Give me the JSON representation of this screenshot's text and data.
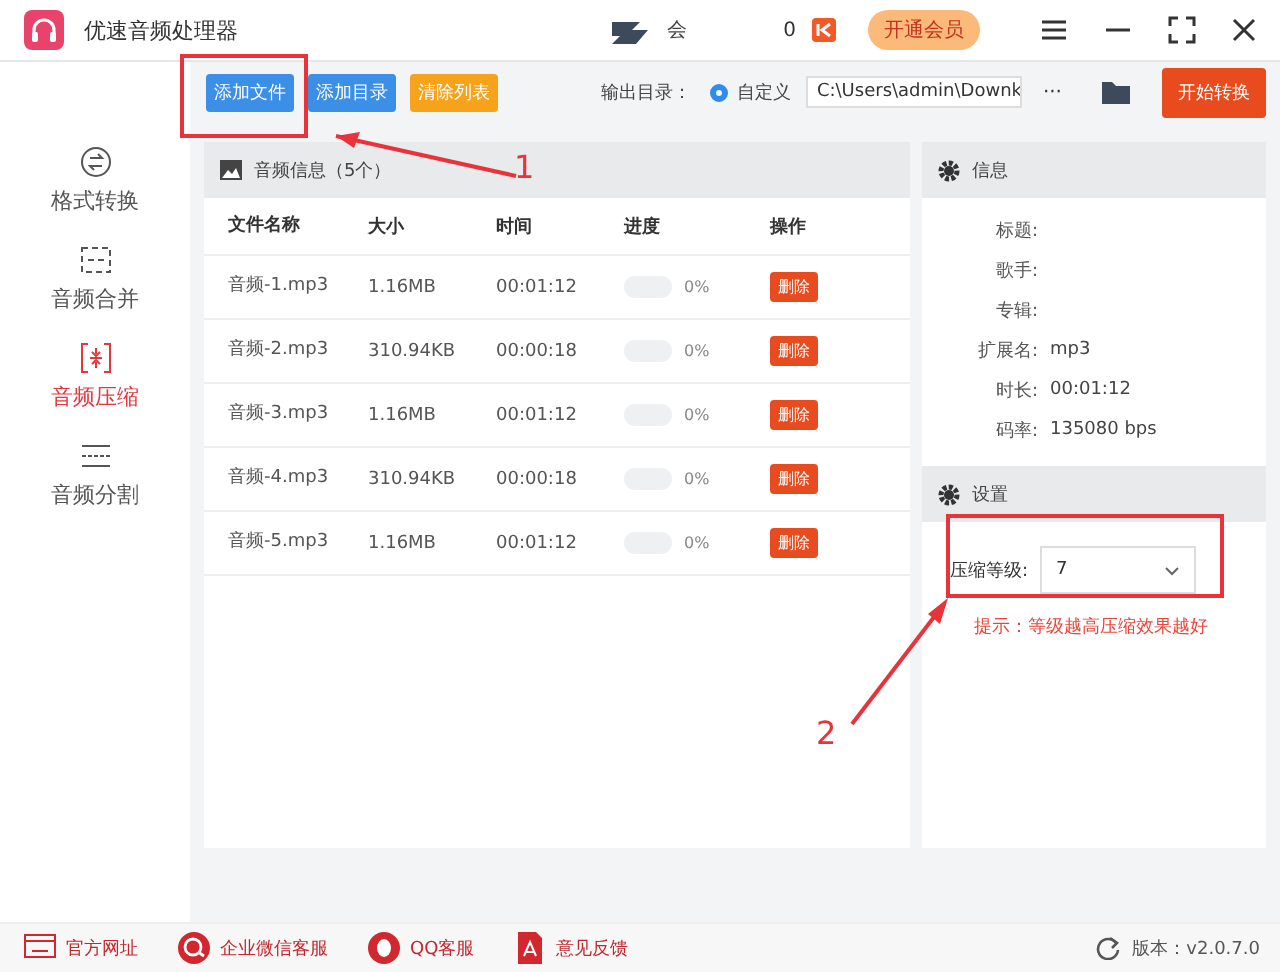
{
  "window": {
    "title": "优速音频处理器",
    "user": "会",
    "coins": "0",
    "vip_button": "开通会员"
  },
  "toolbar": {
    "buttons": [
      {
        "label": "添加文件",
        "kind": "blue"
      },
      {
        "label": "添加目录",
        "kind": "blue"
      },
      {
        "label": "清除列表",
        "kind": "orange"
      }
    ],
    "output_label": "输出目录：",
    "output_option": {
      "label": "自定义",
      "selected": true
    },
    "output_path": "C:\\Users\\admin\\Downk",
    "more": "···",
    "start_button": "开始转换"
  },
  "sidebar": {
    "items": [
      {
        "label": "格式转换",
        "selected": false
      },
      {
        "label": "音频合并",
        "selected": false
      },
      {
        "label": "音频压缩",
        "selected": true
      },
      {
        "label": "音频分割",
        "selected": false
      }
    ]
  },
  "file_panel": {
    "title": "音频信息（5个）",
    "columns": [
      "文件名称",
      "大小",
      "时间",
      "进度",
      "操作"
    ],
    "rows": [
      {
        "name": "音频-1.mp3",
        "size": "1.16MB",
        "time": "00:01:12",
        "reading": "0%",
        "action": "删除"
      },
      {
        "name": "音频-2.mp3",
        "size": "310.94KB",
        "time": "00:00:18",
        "reading": "0%",
        "action": "删除"
      },
      {
        "name": "音频-3.mp3",
        "size": "1.16MB",
        "time": "00:01:12",
        "reading": "0%",
        "action": "删除"
      },
      {
        "name": "音频-4.mp3",
        "size": "310.94KB",
        "time": "00:00:18",
        "reading": "0%",
        "action": "删除"
      },
      {
        "name": "音频-5.mp3",
        "size": "1.16MB",
        "time": "00:01:12",
        "reading": "0%",
        "action": "删除"
      }
    ]
  },
  "info_panel": {
    "title": "信息",
    "fields": [
      {
        "label": "标题:"
      },
      {
        "label": "歌手:"
      },
      {
        "label": "专辑:"
      },
      {
        "label": "扩展名:",
        "value": "mp3"
      },
      {
        "label": "时长:",
        "value": "00:01:12"
      },
      {
        "label": "码率:",
        "value": "135080 bps"
      }
    ]
  },
  "settings_panel": {
    "title": "设置",
    "level_label": "压缩等级:",
    "level_value": "7",
    "hint": "提示：等级越高压缩效果越好"
  },
  "footer": {
    "links": [
      {
        "label": "官方网址"
      },
      {
        "label": "企业微信客服"
      },
      {
        "label": "QQ客服"
      },
      {
        "label": "意见反馈"
      }
    ],
    "version": "版本：v2.0.7.0"
  },
  "annotations": [
    {
      "label": "1"
    },
    {
      "label": "2"
    }
  ]
}
